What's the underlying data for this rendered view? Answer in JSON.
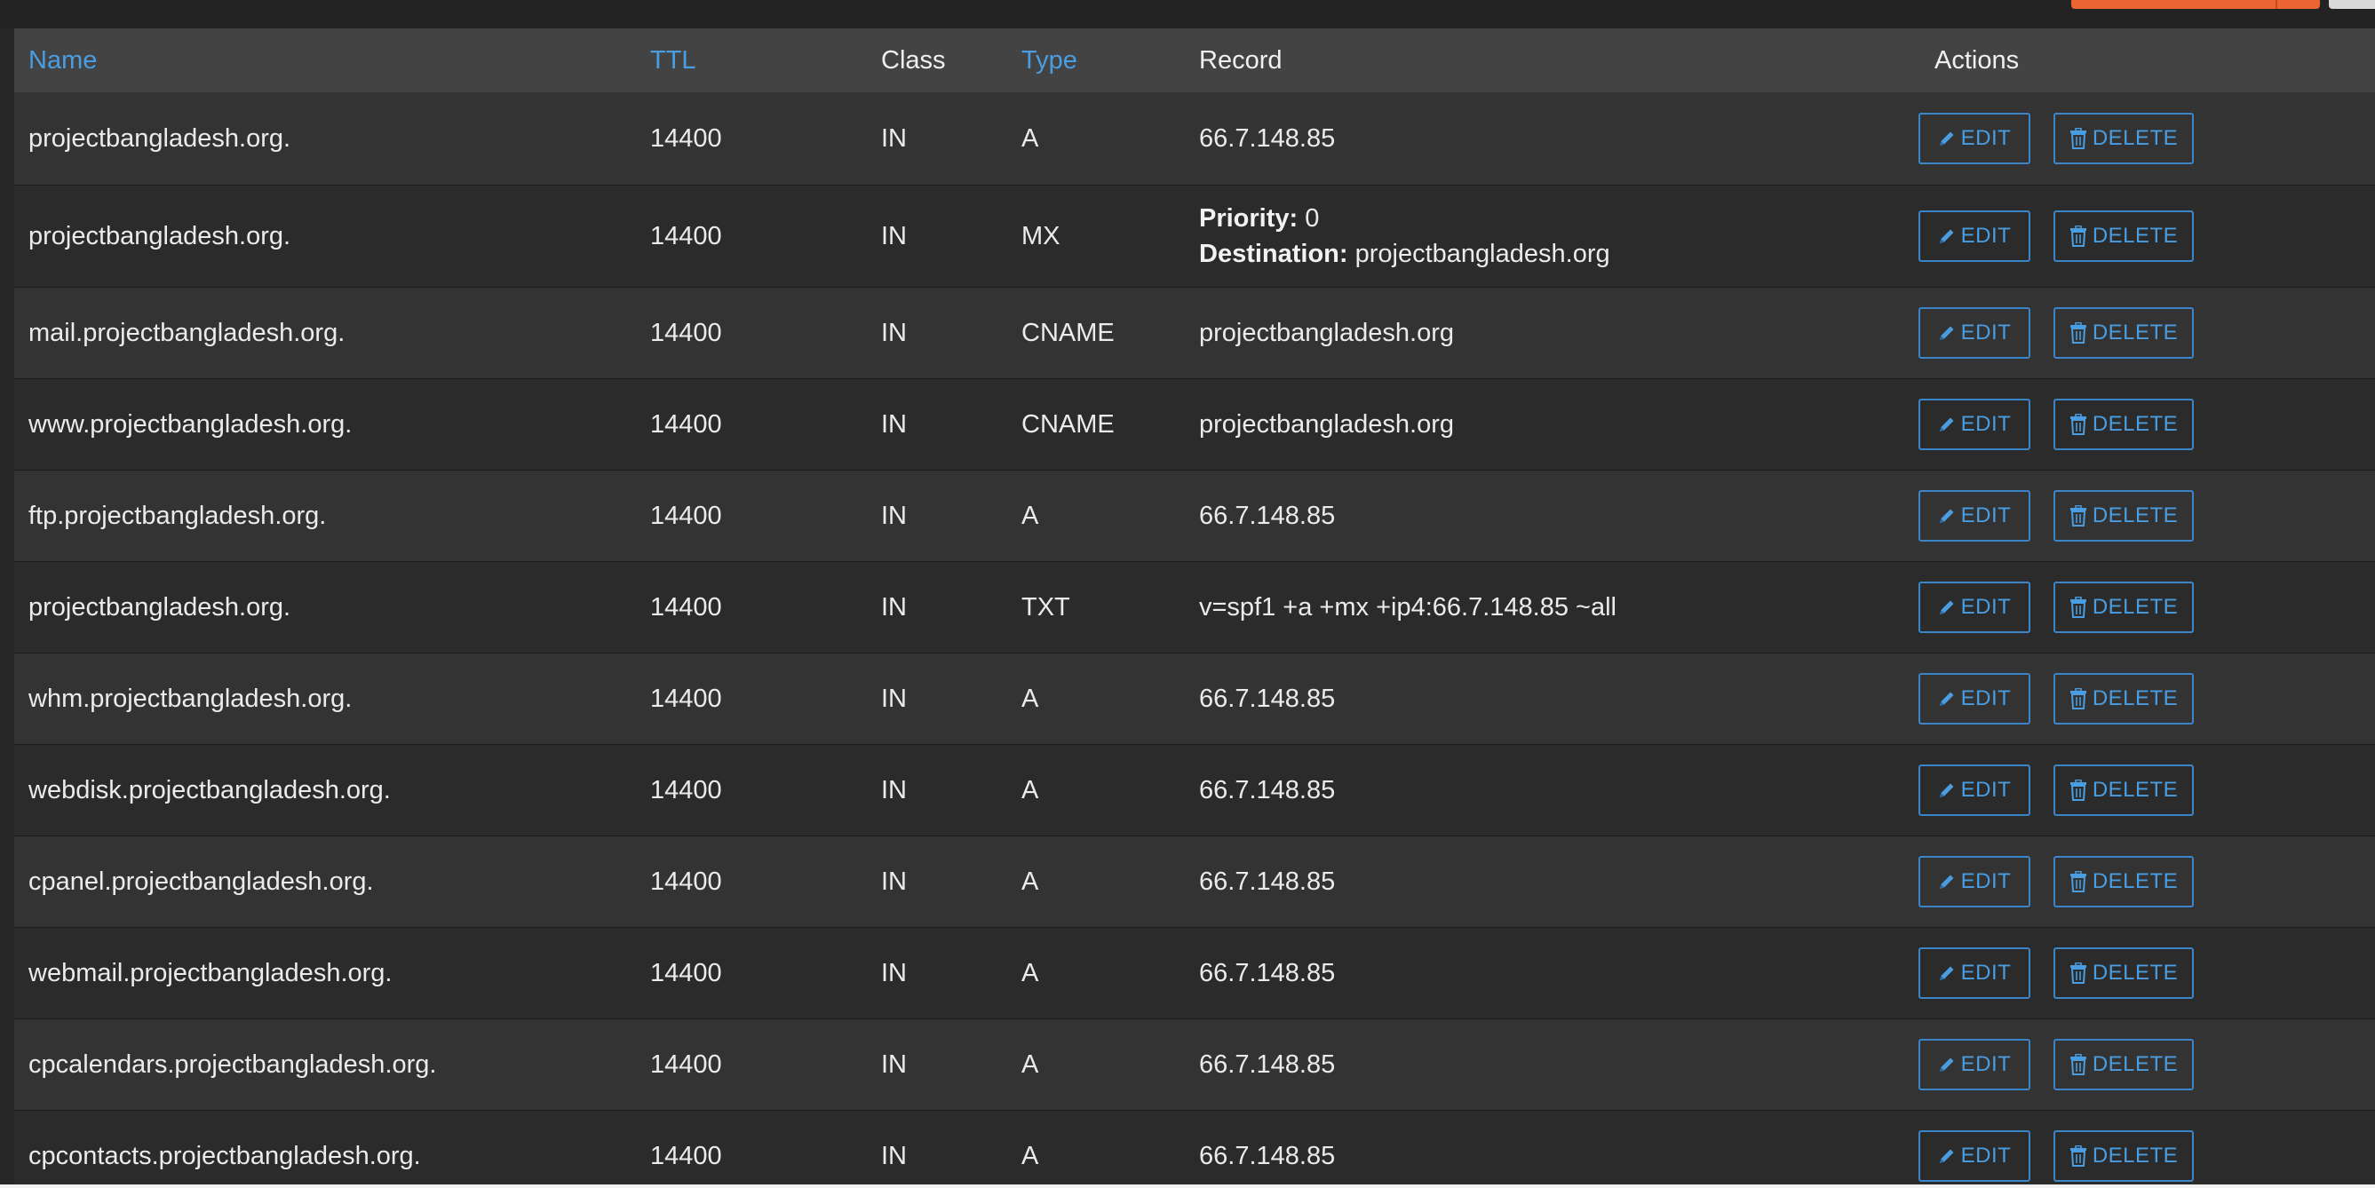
{
  "colors": {
    "page_bg": "#262626",
    "header_bg": "#434343",
    "row_odd": "#333333",
    "row_even": "#2b2b2b",
    "link_blue": "#4a9de0",
    "accent_orange": "#ec6433"
  },
  "table": {
    "headers": {
      "name": "Name",
      "ttl": "TTL",
      "class": "Class",
      "type": "Type",
      "record": "Record",
      "actions": "Actions"
    },
    "edit_label": "EDIT",
    "delete_label": "DELETE",
    "edit_icon": "pencil-icon",
    "delete_icon": "trash-icon",
    "rows": [
      {
        "name": "projectbangladesh.org.",
        "ttl": "14400",
        "class": "IN",
        "type": "A",
        "record": "66.7.148.85"
      },
      {
        "name": "projectbangladesh.org.",
        "ttl": "14400",
        "class": "IN",
        "type": "MX",
        "priority_label": "Priority:",
        "priority": " 0",
        "destination_label": "Destination:",
        "destination": " projectbangladesh.org"
      },
      {
        "name": "mail.projectbangladesh.org.",
        "ttl": "14400",
        "class": "IN",
        "type": "CNAME",
        "record": "projectbangladesh.org"
      },
      {
        "name": "www.projectbangladesh.org.",
        "ttl": "14400",
        "class": "IN",
        "type": "CNAME",
        "record": "projectbangladesh.org"
      },
      {
        "name": "ftp.projectbangladesh.org.",
        "ttl": "14400",
        "class": "IN",
        "type": "A",
        "record": "66.7.148.85"
      },
      {
        "name": "projectbangladesh.org.",
        "ttl": "14400",
        "class": "IN",
        "type": "TXT",
        "record": "v=spf1 +a +mx +ip4:66.7.148.85 ~all"
      },
      {
        "name": "whm.projectbangladesh.org.",
        "ttl": "14400",
        "class": "IN",
        "type": "A",
        "record": "66.7.148.85"
      },
      {
        "name": "webdisk.projectbangladesh.org.",
        "ttl": "14400",
        "class": "IN",
        "type": "A",
        "record": "66.7.148.85"
      },
      {
        "name": "cpanel.projectbangladesh.org.",
        "ttl": "14400",
        "class": "IN",
        "type": "A",
        "record": "66.7.148.85"
      },
      {
        "name": "webmail.projectbangladesh.org.",
        "ttl": "14400",
        "class": "IN",
        "type": "A",
        "record": "66.7.148.85"
      },
      {
        "name": "cpcalendars.projectbangladesh.org.",
        "ttl": "14400",
        "class": "IN",
        "type": "A",
        "record": "66.7.148.85"
      },
      {
        "name": "cpcontacts.projectbangladesh.org.",
        "ttl": "14400",
        "class": "IN",
        "type": "A",
        "record": "66.7.148.85"
      }
    ]
  }
}
